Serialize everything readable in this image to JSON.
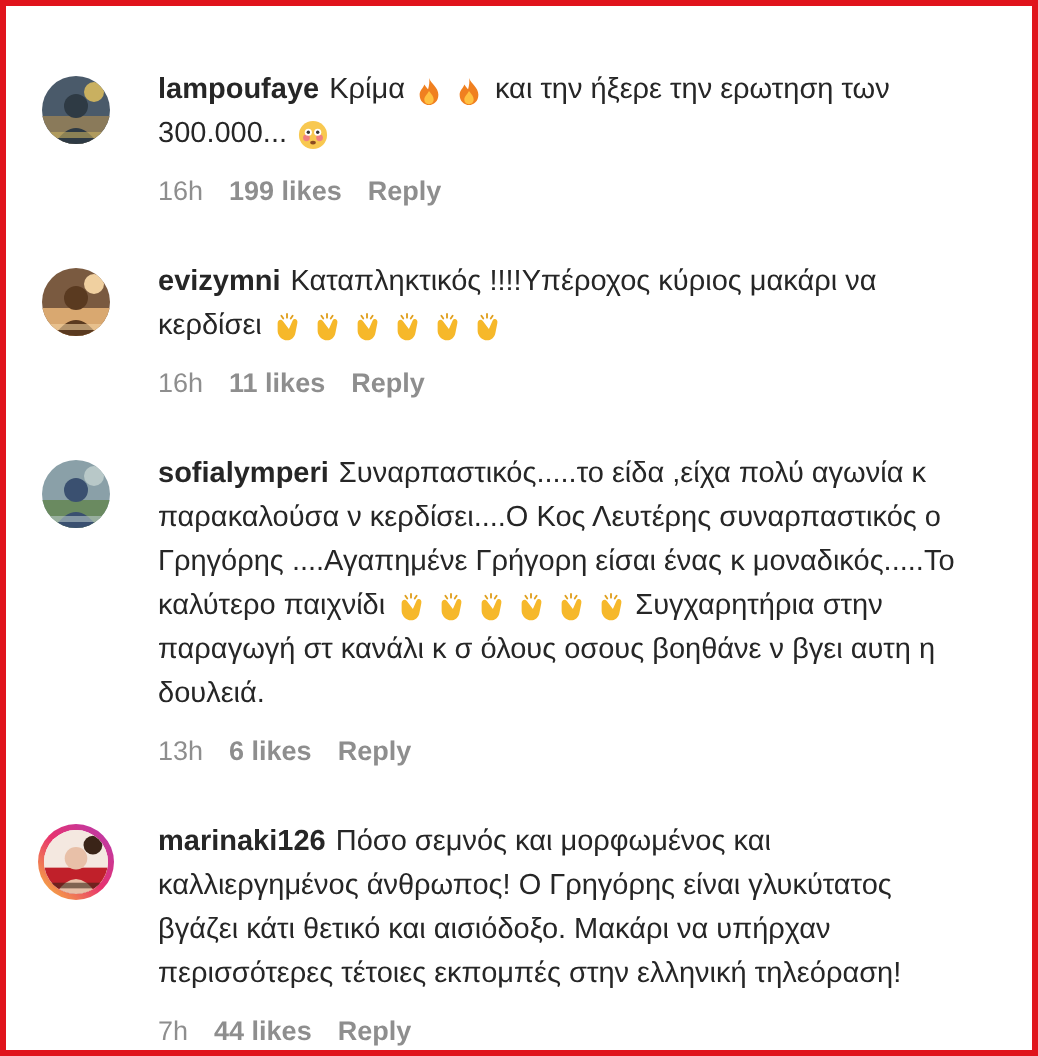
{
  "comments": [
    {
      "username": "lampoufaye",
      "story_ring": false,
      "avatar": {
        "kind": "picture"
      },
      "lines": [
        [
          {
            "kind": "text",
            "text": "Κρίμα"
          },
          {
            "kind": "fire"
          },
          {
            "kind": "fire"
          },
          {
            "kind": "text",
            "text": "και την ήξερε την ερωτηση των"
          }
        ],
        [
          {
            "kind": "text",
            "text": "300.000..."
          },
          {
            "kind": "flushed"
          }
        ]
      ],
      "time": "16h",
      "likes": "199 likes",
      "reply": "Reply"
    },
    {
      "username": "evizymni",
      "story_ring": false,
      "avatar": {
        "kind": "picture"
      },
      "lines": [
        [
          {
            "kind": "text",
            "text": "Καταπληκτικός !!!!Υπέροχος κύριος μακάρι να"
          }
        ],
        [
          {
            "kind": "text",
            "text": "κερδίσει"
          },
          {
            "kind": "clap"
          },
          {
            "kind": "clap"
          },
          {
            "kind": "clap"
          },
          {
            "kind": "clap"
          },
          {
            "kind": "clap"
          },
          {
            "kind": "clap"
          }
        ]
      ],
      "time": "16h",
      "likes": "11 likes",
      "reply": "Reply"
    },
    {
      "username": "sofialymperi",
      "story_ring": false,
      "avatar": {
        "kind": "picture"
      },
      "lines": [
        [
          {
            "kind": "text",
            "text": "Συναρπαστικός.....το είδα ,είχα πολύ αγωνία κ"
          }
        ],
        [
          {
            "kind": "text",
            "text": "παρακαλούσα ν κερδίσει....Ο Κος Λευτέρης συναρπαστικός ο"
          }
        ],
        [
          {
            "kind": "text",
            "text": "Γρηγόρης ....Αγαπημένε Γρήγορη είσαι ένας κ μοναδικός.....Το"
          }
        ],
        [
          {
            "kind": "text",
            "text": "καλύτερο παιχνίδι"
          },
          {
            "kind": "clap"
          },
          {
            "kind": "clap"
          },
          {
            "kind": "clap"
          },
          {
            "kind": "clap"
          },
          {
            "kind": "clap"
          },
          {
            "kind": "clap"
          },
          {
            "kind": "text",
            "text": "Συγχαρητήρια στην"
          }
        ],
        [
          {
            "kind": "text",
            "text": "παραγωγή στ κανάλι κ σ όλους οσους βοηθάνε ν βγει αυτη η"
          }
        ],
        [
          {
            "kind": "text",
            "text": "δουλειά."
          }
        ]
      ],
      "time": "13h",
      "likes": "6 likes",
      "reply": "Reply"
    },
    {
      "username": "marinaki126",
      "story_ring": true,
      "avatar": {
        "kind": "picture"
      },
      "lines": [
        [
          {
            "kind": "text",
            "text": "Πόσο σεμνός και μορφωμένος και"
          }
        ],
        [
          {
            "kind": "text",
            "text": "καλλιεργημένος άνθρωπος! Ο Γρηγόρης είναι γλυκύτατος"
          }
        ],
        [
          {
            "kind": "text",
            "text": "βγάζει κάτι θετικό και αισιόδοξο. Μακάρι να υπήρχαν"
          }
        ],
        [
          {
            "kind": "text",
            "text": "περισσότερες τέτοιες εκπομπές στην ελληνική τηλεόραση!"
          }
        ]
      ],
      "time": "7h",
      "likes": "44 likes",
      "reply": "Reply"
    }
  ]
}
